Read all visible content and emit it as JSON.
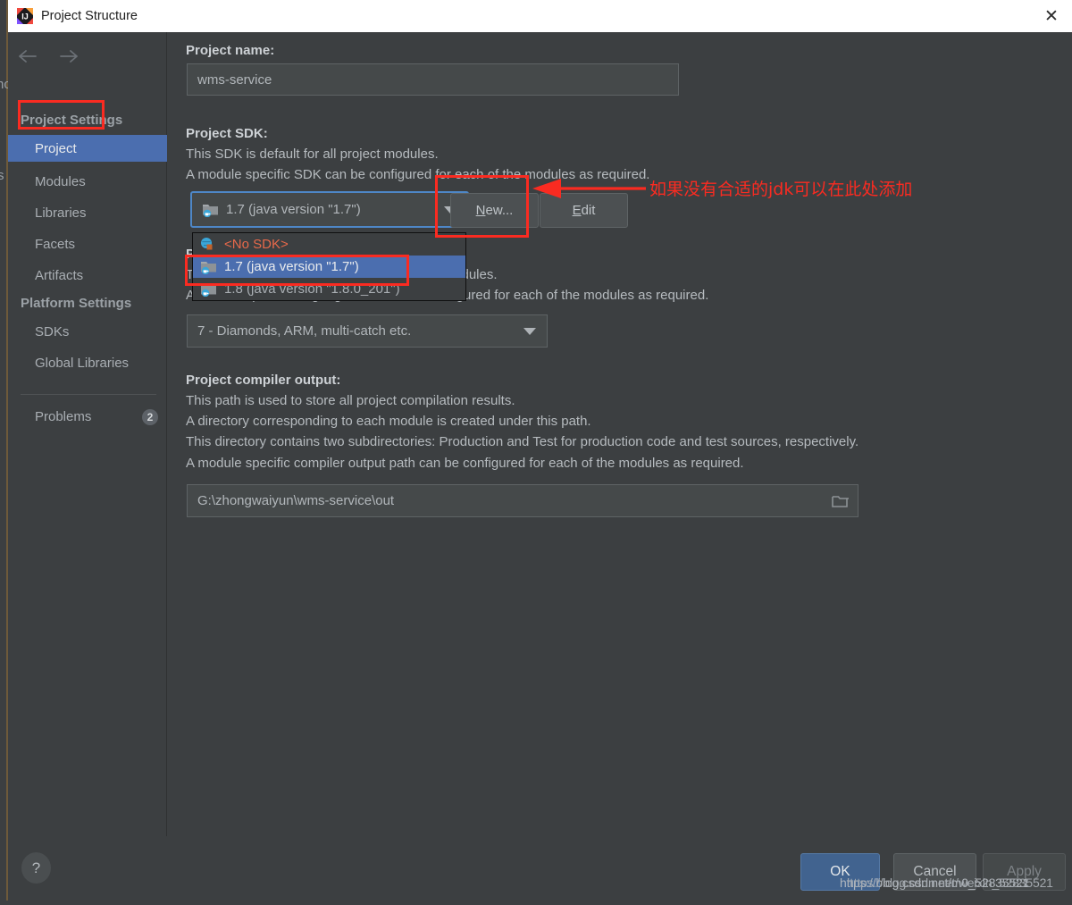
{
  "window": {
    "title": "Project Structure",
    "icon": "intellij-idea-icon",
    "close_label": "✕"
  },
  "nav": {
    "back_icon": "arrow-left-icon",
    "forward_icon": "arrow-right-icon"
  },
  "sidebar": {
    "groups": [
      {
        "label": "Project Settings"
      },
      {
        "label": "Platform Settings"
      }
    ],
    "project_settings_items": [
      {
        "label": "Project",
        "selected": true
      },
      {
        "label": "Modules",
        "selected": false
      },
      {
        "label": "Libraries",
        "selected": false
      },
      {
        "label": "Facets",
        "selected": false
      },
      {
        "label": "Artifacts",
        "selected": false
      }
    ],
    "platform_settings_items": [
      {
        "label": "SDKs",
        "selected": false
      },
      {
        "label": "Global Libraries",
        "selected": false
      }
    ],
    "problems": {
      "label": "Problems",
      "count": "2"
    }
  },
  "main": {
    "project_name": {
      "label": "Project name:",
      "value": "wms-service"
    },
    "project_sdk": {
      "label": "Project SDK:",
      "desc_line_1": "This SDK is default for all project modules.",
      "desc_line_2": "A module specific SDK can be configured for each of the modules as required.",
      "selected": "1.7 (java version \"1.7\")",
      "new_button": {
        "prefix": "",
        "accel": "N",
        "suffix": "ew..."
      },
      "edit_button": {
        "prefix": "",
        "accel": "E",
        "suffix": "dit"
      },
      "options": [
        {
          "label": "<No SDK>",
          "state": "no-sdk"
        },
        {
          "label": "1.7 (java version \"1.7\")",
          "state": "highlighted"
        },
        {
          "label": "1.8 (java version \"1.8.0_201\")",
          "state": "normal"
        }
      ]
    },
    "language_level": {
      "value": "7 - Diamonds, ARM, multi-catch etc."
    },
    "project_language_level_hidden": {
      "label": "Project language level:",
      "desc_line_1": "This language level is default for all project modules.",
      "desc_line_2": "A module specific language level can be configured for each of the modules as required."
    },
    "compiler_output": {
      "label": "Project compiler output:",
      "desc_line_1": "This path is used to store all project compilation results.",
      "desc_line_2": "A directory corresponding to each module is created under this path.",
      "desc_line_3": "This directory contains two subdirectories: Production and Test for production code and test sources, respectively.",
      "desc_line_4": "A module specific compiler output path can be configured for each of the modules as required.",
      "value": "G:\\zhongwaiyun\\wms-service\\out",
      "browse_icon": "folder-icon"
    }
  },
  "annotations": {
    "chinese_note": "如果没有合适的jdk可以在此处添加",
    "arrow_icon": "red-arrow-left-icon",
    "accent_color": "#fa2b21"
  },
  "footer": {
    "help_label": "?",
    "ok_label": "OK",
    "cancel_label": "Cancel",
    "apply_label": "Apply"
  },
  "watermark": {
    "line_a": "https://blog.csdn.net/m0_52835521",
    "line_b": "https://blog.csdn.net/weixin_52835521"
  },
  "background": {
    "ghost_left_1": "nc",
    "ghost_left_2": "s"
  },
  "colors": {
    "dialog_bg": "#3c3f41",
    "selection_blue": "#4b6eaf",
    "annotation_red": "#fa2b21",
    "ok_blue": "#41638f",
    "no_sdk_orange": "#e8694a"
  }
}
